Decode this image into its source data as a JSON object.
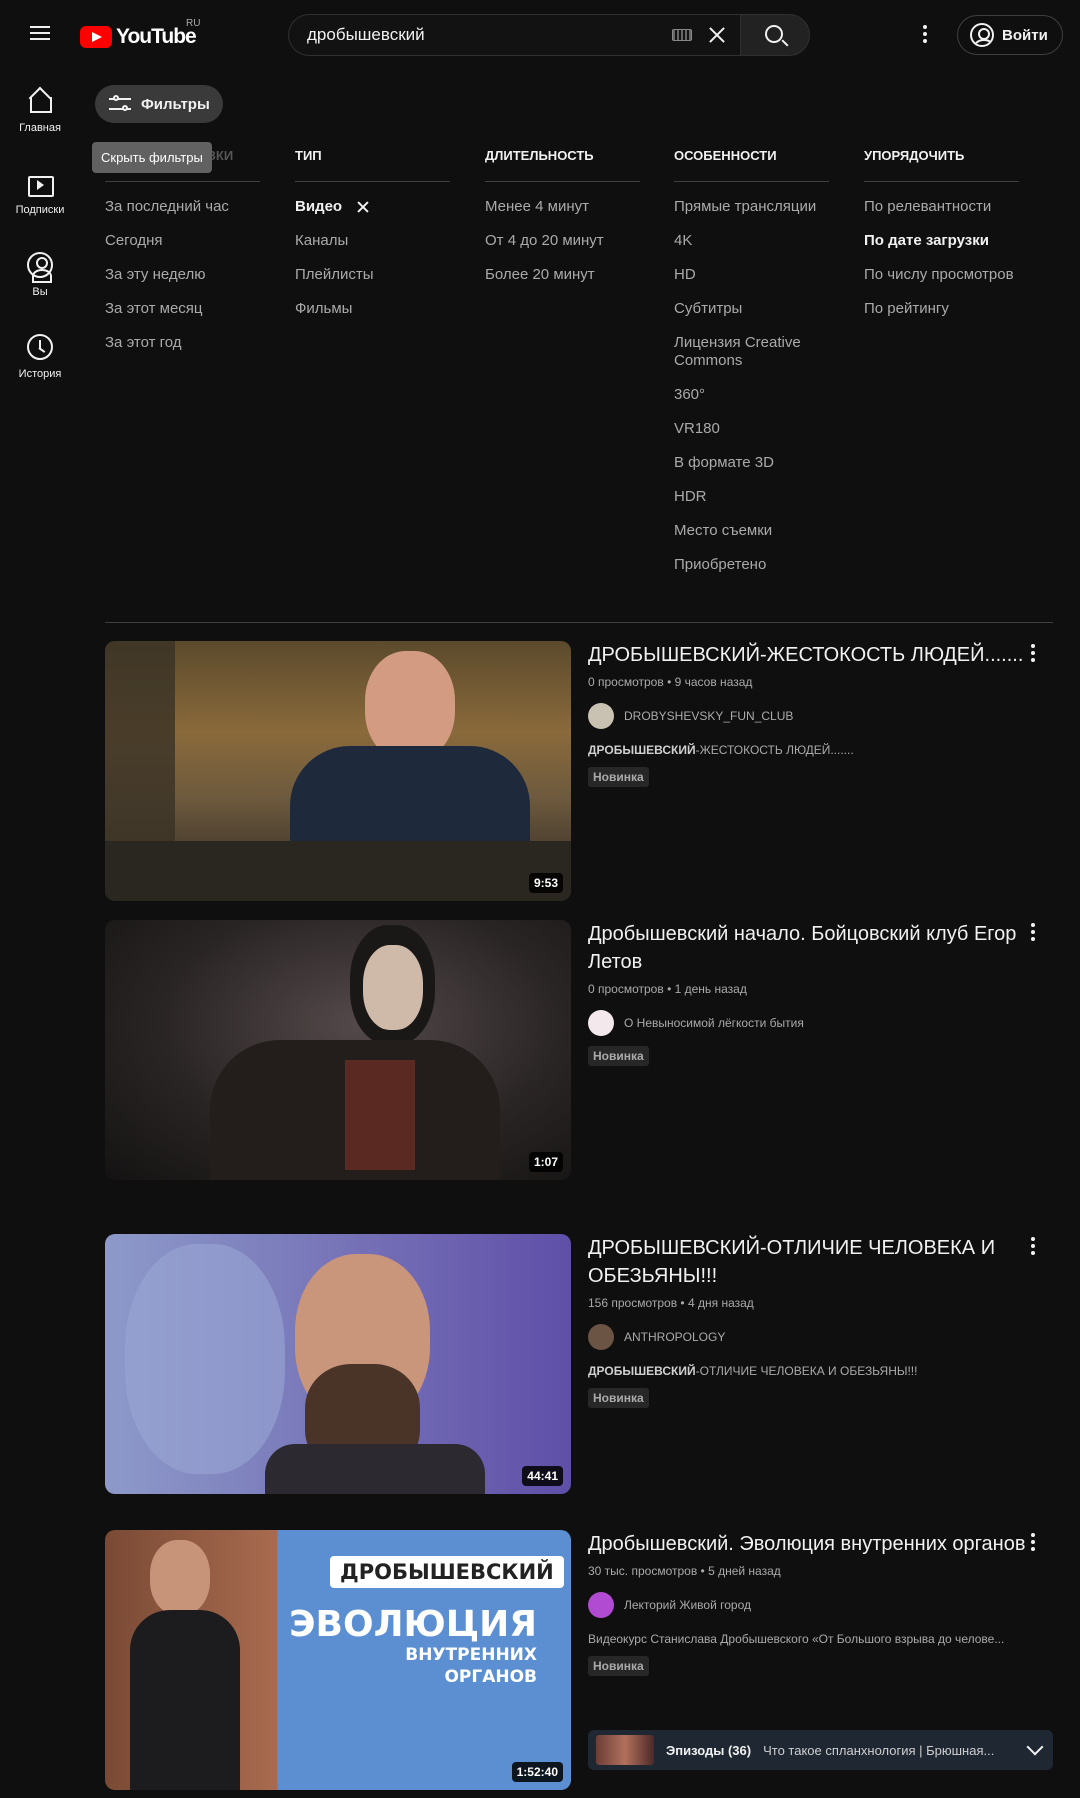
{
  "header": {
    "logo_text": "YouTube",
    "region": "RU",
    "search_value": "дробышевский",
    "signin_label": "Войти"
  },
  "sidebar": {
    "items": [
      {
        "label": "Главная",
        "icon": "home-icon"
      },
      {
        "label": "Подписки",
        "icon": "subscriptions-icon"
      },
      {
        "label": "Вы",
        "icon": "you-icon"
      },
      {
        "label": "История",
        "icon": "history-icon"
      }
    ]
  },
  "filters": {
    "button_label": "Фильтры",
    "tooltip": "Скрыть фильтры",
    "columns": [
      {
        "title": "ПО ДАТЕ ЗАГРУЗКИ",
        "items": [
          "За последний час",
          "Сегодня",
          "За эту неделю",
          "За этот месяц",
          "За этот год"
        ]
      },
      {
        "title": "ТИП",
        "items": [
          "Видео",
          "Каналы",
          "Плейлисты",
          "Фильмы"
        ]
      },
      {
        "title": "ДЛИТЕЛЬНОСТЬ",
        "items": [
          "Менее 4 минут",
          "От 4 до 20 минут",
          "Более 20 минут"
        ]
      },
      {
        "title": "ОСОБЕННОСТИ",
        "items": [
          "Прямые трансляции",
          "4K",
          "HD",
          "Субтитры",
          "Лицензия Creative Commons",
          "360°",
          "VR180",
          "В формате 3D",
          "HDR",
          "Место съемки",
          "Приобретено"
        ]
      },
      {
        "title": "УПОРЯДОЧИТЬ",
        "items": [
          "По релевантности",
          "По дате загрузки",
          "По числу просмотров",
          "По рейтингу"
        ]
      }
    ]
  },
  "results": [
    {
      "title": "ДРОБЫШЕВСКИЙ-ЖЕСТОКОСТЬ ЛЮДЕЙ.......",
      "views": "0 просмотров",
      "age": "9 часов назад",
      "channel": "DROBYSHEVSKY_FUN_CLUB",
      "desc_bold": "ДРОБЫШЕВСКИЙ",
      "desc_rest": "-ЖЕСТОКОСТЬ ЛЮДЕЙ.......",
      "badge": "Новинка",
      "duration": "9:53"
    },
    {
      "title": "Дробышевский начало. Бойцовский клуб Егор Летов",
      "views": "0 просмотров",
      "age": "1 день назад",
      "channel": "О Невыносимой лёгкости бытия",
      "badge": "Новинка",
      "duration": "1:07"
    },
    {
      "title": "ДРОБЫШЕВСКИЙ-ОТЛИЧИЕ ЧЕЛОВЕКА И ОБЕЗЬЯНЫ!!!",
      "views": "156 просмотров",
      "age": "4 дня назад",
      "channel": "ANTHROPOLOGY",
      "desc_bold": "ДРОБЫШЕВСКИЙ",
      "desc_rest": "-ОТЛИЧИЕ ЧЕЛОВЕКА И ОБЕЗЬЯНЫ!!!",
      "badge": "Новинка",
      "duration": "44:41"
    },
    {
      "title": "Дробышевский. Эволюция внутренних органов",
      "views": "30 тыс. просмотров",
      "age": "5 дней назад",
      "channel": "Лекторий Живой город",
      "desc": "Видеокурс Станислава Дробышевского «От Большого взрыва до челове...",
      "badge": "Новинка",
      "duration": "1:52:40",
      "thumb_text": {
        "line1": "ДРОБЫШЕВСКИЙ",
        "line2": "ЭВОЛЮЦИЯ",
        "line3": "ВНУТРЕННИХ",
        "line4": "ОРГАНОВ"
      },
      "episodes": {
        "label": "Эпизоды (36)",
        "title": "Что такое спланхнология | Брюшная..."
      }
    }
  ],
  "colors": {
    "background": "#0f0f0f",
    "brand": "#ff0000",
    "text": "#f1f1f1",
    "muted": "#aaaaaa"
  }
}
